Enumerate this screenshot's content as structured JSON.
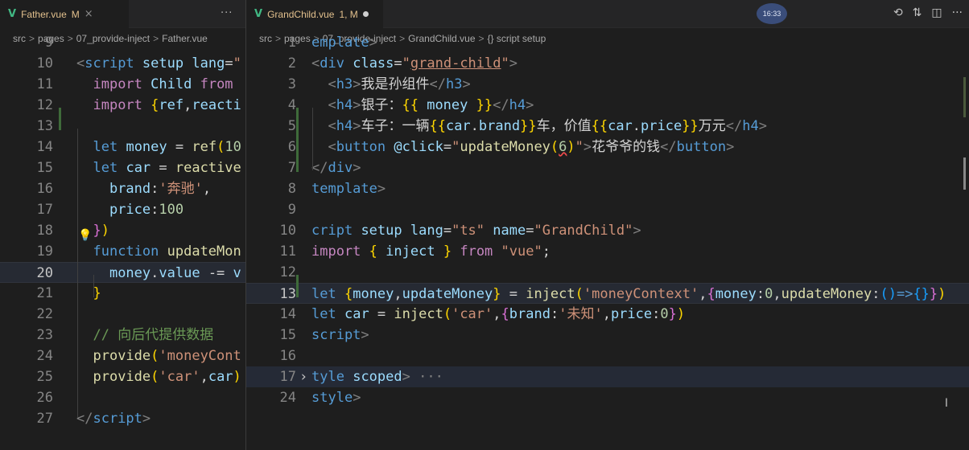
{
  "left_editor": {
    "tab": {
      "filename": "Father.vue",
      "status": "M"
    },
    "tab_close_icon": "×",
    "more_icon": "···",
    "breadcrumb": {
      "parts": [
        "src",
        "pages",
        "07_provide-inject",
        "Father.vue"
      ],
      "separator": ">"
    },
    "lines": [
      {
        "n": "9",
        "html": ""
      },
      {
        "n": "10",
        "html": "<span class=\"t\">&lt;</span><span class=\"tag\">script</span> <span class=\"at\">setup</span> <span class=\"at\">lang</span>=<span class=\"str\">\"</span>"
      },
      {
        "n": "11",
        "html": "  <span class=\"kw2\">import</span> <span class=\"var\">Child</span> <span class=\"kw2\">from</span>"
      },
      {
        "n": "12",
        "html": "  <span class=\"kw2\">import</span> <span class=\"br\">{</span><span class=\"var\">ref</span>,<span class=\"var\">reacti</span>"
      },
      {
        "n": "13",
        "html": ""
      },
      {
        "n": "14",
        "html": "  <span class=\"kw\">let</span> <span class=\"var\">money</span> = <span class=\"fn\">ref</span><span class=\"br\">(</span><span class=\"num\">10</span>"
      },
      {
        "n": "15",
        "html": "  <span class=\"kw\">let</span> <span class=\"var\">car</span> = <span class=\"fn\">reactive</span>"
      },
      {
        "n": "16",
        "html": "    <span class=\"var\">brand</span>:<span class=\"str\">'奔驰'</span>,"
      },
      {
        "n": "17",
        "html": "    <span class=\"var\">price</span>:<span class=\"num\">100</span>"
      },
      {
        "n": "18",
        "html": "  <span class=\"br2\">}</span><span class=\"br\">)</span>"
      },
      {
        "n": "19",
        "html": "  <span class=\"kw\">function</span> <span class=\"fn\">updateMon</span>"
      },
      {
        "n": "20",
        "html": "    <span class=\"var\">money</span>.<span class=\"var\">value</span> -= <span class=\"var\">v</span>"
      },
      {
        "n": "21",
        "html": "  <span class=\"br\">}</span>"
      },
      {
        "n": "22",
        "html": ""
      },
      {
        "n": "23",
        "html": "  <span class=\"cm\">// 向后代提供数据</span>"
      },
      {
        "n": "24",
        "html": "  <span class=\"fn\">provide</span><span class=\"br\">(</span><span class=\"str\">'moneyCont</span>"
      },
      {
        "n": "25",
        "html": "  <span class=\"fn\">provide</span><span class=\"br\">(</span><span class=\"str\">'car'</span>,<span class=\"var\">car</span><span class=\"br\">)</span>"
      },
      {
        "n": "26",
        "html": ""
      },
      {
        "n": "27",
        "html": "<span class=\"t\">&lt;/</span><span class=\"tag\">script</span><span class=\"t\">&gt;</span>"
      }
    ]
  },
  "right_editor": {
    "tab": {
      "filename": "GrandChild.vue",
      "status": "1, M"
    },
    "clock": "16:33",
    "breadcrumb": {
      "parts": [
        "src",
        "pages",
        "07_provide-inject",
        "GrandChild.vue",
        "{} script setup"
      ],
      "separator": ">"
    },
    "lines": [
      {
        "n": "1",
        "html": "<span class=\"tag\">emplate</span><span class=\"t\">&gt;</span>"
      },
      {
        "n": "2",
        "html": "<span class=\"t\">&lt;</span><span class=\"tag\">div</span> <span class=\"at\">class</span>=<span class=\"str\">\"<u>grand-child</u>\"</span><span class=\"t\">&gt;</span>"
      },
      {
        "n": "3",
        "html": "  <span class=\"t\">&lt;</span><span class=\"tag\">h3</span><span class=\"t\">&gt;</span>我是孙组件<span class=\"t\">&lt;/</span><span class=\"tag\">h3</span><span class=\"t\">&gt;</span>"
      },
      {
        "n": "4",
        "html": "  <span class=\"t\">&lt;</span><span class=\"tag\">h4</span><span class=\"t\">&gt;</span>银子：<span class=\"br\">{{</span> <span class=\"var\">money</span> <span class=\"br\">}}</span><span class=\"t\">&lt;/</span><span class=\"tag\">h4</span><span class=\"t\">&gt;</span>"
      },
      {
        "n": "5",
        "html": "  <span class=\"t\">&lt;</span><span class=\"tag\">h4</span><span class=\"t\">&gt;</span>车子：一辆<span class=\"br\">{{</span><span class=\"var\">car</span>.<span class=\"var\">brand</span><span class=\"br\">}}</span>车，价值<span class=\"br\">{{</span><span class=\"var\">car</span>.<span class=\"var\">price</span><span class=\"br\">}}</span>万元<span class=\"t\">&lt;/</span><span class=\"tag\">h4</span><span class=\"t\">&gt;</span>"
      },
      {
        "n": "6",
        "html": "  <span class=\"t\">&lt;</span><span class=\"tag\">button</span> <span class=\"at\">@click</span>=<span class=\"str\">\"</span><span class=\"fn\">updateMoney</span><span class=\"br\">(</span><span class=\"num sq\">6</span><span class=\"br\">)</span><span class=\"str\">\"</span><span class=\"t\">&gt;</span>花爷爷的钱<span class=\"t\">&lt;/</span><span class=\"tag\">button</span><span class=\"t\">&gt;</span>"
      },
      {
        "n": "7",
        "html": "<span class=\"t\">&lt;/</span><span class=\"tag\">div</span><span class=\"t\">&gt;</span>"
      },
      {
        "n": "8",
        "html": "<span class=\"tag\">template</span><span class=\"t\">&gt;</span>"
      },
      {
        "n": "9",
        "html": ""
      },
      {
        "n": "10",
        "html": "<span class=\"tag\">cript</span> <span class=\"at\">setup</span> <span class=\"at\">lang</span>=<span class=\"str\">\"ts\"</span> <span class=\"at\">name</span>=<span class=\"str\">\"GrandChild\"</span><span class=\"t\">&gt;</span>"
      },
      {
        "n": "11",
        "html": "<span class=\"kw2\">import</span> <span class=\"br\">{</span> <span class=\"var\">inject</span> <span class=\"br\">}</span> <span class=\"kw2\">from</span> <span class=\"str\">\"vue\"</span>;"
      },
      {
        "n": "12",
        "html": ""
      },
      {
        "n": "13",
        "html": "<span class=\"kw\">let</span> <span class=\"br\">{</span><span class=\"var\">money</span>,<span class=\"var\">updateMoney</span><span class=\"br\">}</span> = <span class=\"fn\">inject</span><span class=\"br\">(</span><span class=\"str\">'moneyContext'</span>,<span class=\"br2\">{</span><span class=\"var\">money</span>:<span class=\"num\">0</span>,<span class=\"fn\">updateMoney</span>:<span class=\"br3\">()</span><span class=\"kw\">=&gt;</span><span class=\"br3\">{}</span><span class=\"br2\">}</span><span class=\"br\">)</span>"
      },
      {
        "n": "14",
        "html": "<span class=\"kw\">let</span> <span class=\"var\">car</span> = <span class=\"fn\">inject</span><span class=\"br\">(</span><span class=\"str\">'car'</span>,<span class=\"br2\">{</span><span class=\"var\">brand</span>:<span class=\"str\">'未知'</span>,<span class=\"var\">price</span>:<span class=\"num\">0</span><span class=\"br2\">}</span><span class=\"br\">)</span>"
      },
      {
        "n": "15",
        "html": "<span class=\"tag\">script</span><span class=\"t\">&gt;</span>"
      },
      {
        "n": "16",
        "html": ""
      },
      {
        "n": "17",
        "html": "<span class=\"tag\">tyle</span> <span class=\"at\">scoped</span><span class=\"t\">&gt;</span> <span class=\"t\">···</span>"
      },
      {
        "n": "24",
        "html": "<span class=\"tag\">style</span><span class=\"t\">&gt;</span>"
      }
    ],
    "fold_chevron": "›",
    "toolbar_icons": [
      "timeline-icon",
      "compare-icon",
      "split-editor-icon",
      "more-actions-icon"
    ],
    "toolbar_glyphs": [
      "⟲",
      "⇅",
      "◫",
      "···"
    ]
  }
}
